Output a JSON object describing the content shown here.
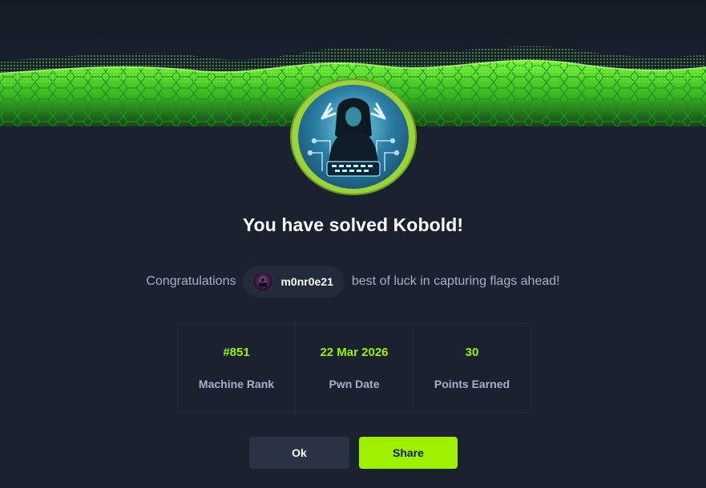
{
  "modal": {
    "title": "You have solved Kobold!",
    "banner_icon": "green-hex-grid-wave",
    "machine_avatar_icon": "hooded-hacker-icon"
  },
  "congrats": {
    "prefix": "Congratulations",
    "username": "m0nr0e21",
    "suffix": "best of luck in capturing flags ahead!",
    "user_avatar_icon": "user-avatar"
  },
  "stats": [
    {
      "value": "#851",
      "label": "Machine Rank"
    },
    {
      "value": "22 Mar 2026",
      "label": "Pwn Date"
    },
    {
      "value": "30",
      "label": "Points Earned"
    }
  ],
  "buttons": {
    "ok_label": "Ok",
    "share_label": "Share"
  },
  "colors": {
    "accent": "#9fef00",
    "background": "#1a2230",
    "muted_text": "#a4b1cd",
    "ring": "#9ad33a"
  }
}
